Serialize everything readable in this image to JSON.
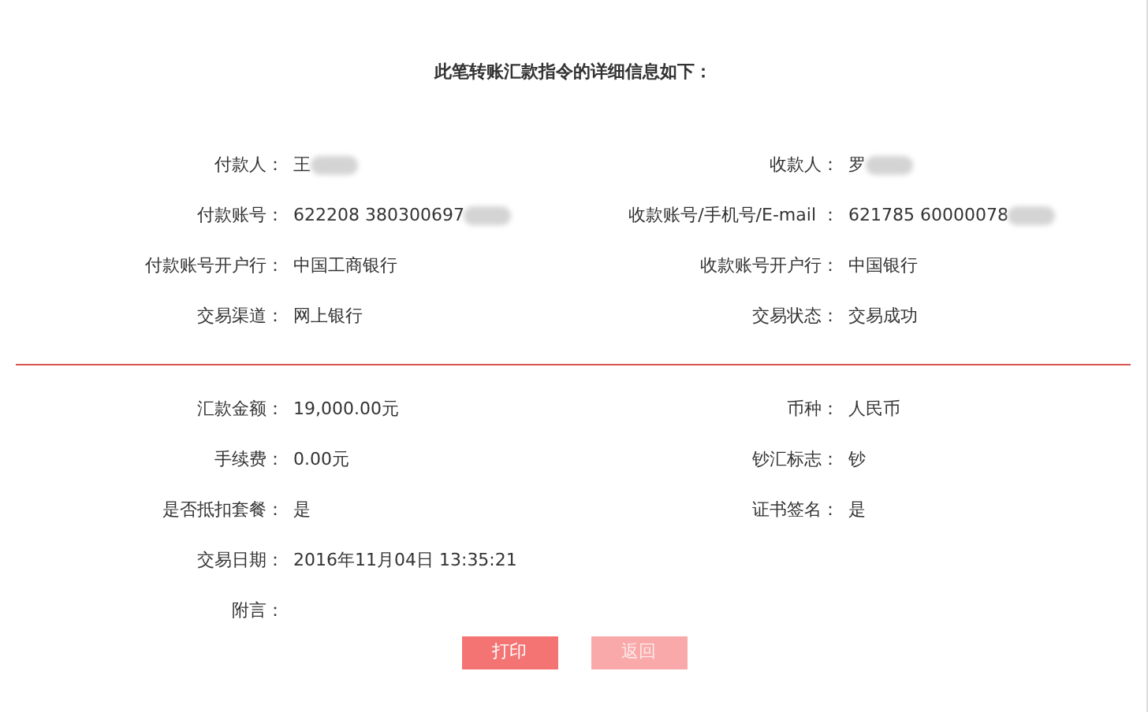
{
  "title": "此笔转账汇款指令的详细信息如下：",
  "sections": [
    {
      "rows": [
        {
          "left": {
            "label": "付款人：",
            "value": "王",
            "redacted": true
          },
          "right": {
            "label": "收款人：",
            "value": "罗",
            "redacted": true
          }
        },
        {
          "left": {
            "label": "付款账号：",
            "value": "622208 380300697",
            "redacted": true
          },
          "right": {
            "label": "收款账号/手机号/E-mail ：",
            "value": "621785 60000078",
            "redacted": true
          }
        },
        {
          "left": {
            "label": "付款账号开户行：",
            "value": "中国工商银行"
          },
          "right": {
            "label": "收款账号开户行：",
            "value": "中国银行"
          }
        },
        {
          "left": {
            "label": "交易渠道：",
            "value": "网上银行"
          },
          "right": {
            "label": "交易状态：",
            "value": "交易成功"
          }
        }
      ]
    },
    {
      "rows": [
        {
          "left": {
            "label": "汇款金额：",
            "value": "19,000.00元"
          },
          "right": {
            "label": "币种：",
            "value": "人民币"
          }
        },
        {
          "left": {
            "label": "手续费：",
            "value": "0.00元"
          },
          "right": {
            "label": "钞汇标志：",
            "value": "钞"
          }
        },
        {
          "left": {
            "label": "是否抵扣套餐：",
            "value": "是"
          },
          "right": {
            "label": "证书签名：",
            "value": "是"
          }
        },
        {
          "left": {
            "label": "交易日期：",
            "value": "2016年11月04日 13:35:21"
          }
        },
        {
          "left": {
            "label": "附言："
          }
        }
      ]
    }
  ],
  "buttons": [
    {
      "label": "打印",
      "disabled": false
    },
    {
      "label": "返回",
      "disabled": true
    }
  ]
}
